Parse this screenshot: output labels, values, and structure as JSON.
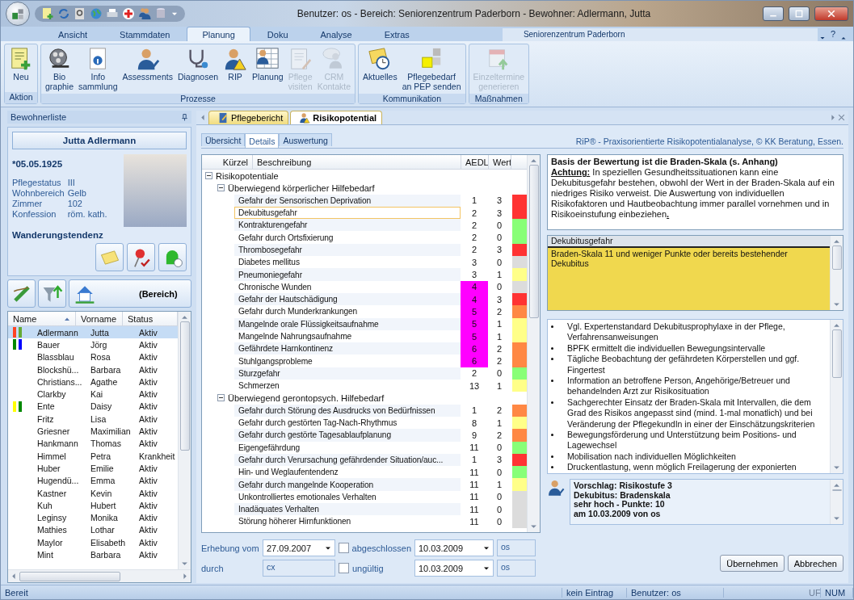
{
  "window": {
    "title": "Benutzer: os - Bereich: Seniorenzentrum Paderborn - Bewohner: Adlermann, Jutta"
  },
  "ribbon": {
    "tabs": [
      {
        "label": "Ansicht",
        "selected": false
      },
      {
        "label": "Stammdaten",
        "selected": false
      },
      {
        "label": "Planung",
        "selected": true
      },
      {
        "label": "Doku",
        "selected": false
      },
      {
        "label": "Analyse",
        "selected": false
      },
      {
        "label": "Extras",
        "selected": false
      }
    ],
    "area_label": "Seniorenzentrum Paderborn",
    "help": "?",
    "groups": [
      {
        "label": "Aktion",
        "buttons": [
          {
            "label": "Neu",
            "disabled": false
          }
        ]
      },
      {
        "label": "Prozesse",
        "buttons": [
          {
            "label": "Bio\ngraphie",
            "disabled": false
          },
          {
            "label": "Info\nsammlung",
            "disabled": false
          },
          {
            "label": "Assessments",
            "disabled": false
          },
          {
            "label": "Diagnosen",
            "disabled": false
          },
          {
            "label": "RIP",
            "disabled": false
          },
          {
            "label": "Planung",
            "disabled": false
          },
          {
            "label": "Pflege\nvisiten",
            "disabled": true
          },
          {
            "label": "CRM\nKontakte",
            "disabled": true
          }
        ]
      },
      {
        "label": "Kommunikation",
        "buttons": [
          {
            "label": "Aktuelles",
            "disabled": false
          },
          {
            "label": "Pflegebedarf\nan PEP senden",
            "disabled": false
          }
        ]
      },
      {
        "label": "Maßnahmen",
        "buttons": [
          {
            "label": "Einzeltermine\ngenerieren",
            "disabled": true
          }
        ]
      }
    ]
  },
  "sidebar": {
    "title": "Bewohnerliste",
    "resident": {
      "name": "Jutta Adlermann",
      "birth": "*05.05.1925",
      "fields": [
        {
          "label": "Pflegestatus",
          "value": "III"
        },
        {
          "label": "Wohnbereich",
          "value": "Gelb"
        },
        {
          "label": "Zimmer",
          "value": "102"
        },
        {
          "label": "Konfession",
          "value": "röm. kath."
        }
      ],
      "alert": "Wanderungstendenz"
    },
    "filter_label": "(Bereich)",
    "columns": [
      "Name",
      "Vorname",
      "Status"
    ],
    "rows": [
      {
        "name": "Adlermann",
        "first": "Jutta",
        "status": "Aktiv",
        "selected": true,
        "markers": [
          {
            "color": "#ff4422"
          },
          {
            "color": "#66aa33"
          }
        ]
      },
      {
        "name": "Bauer",
        "first": "Jörg",
        "status": "Aktiv",
        "selected": false,
        "markers": [
          {
            "color": "#008800"
          },
          {
            "color": "#0000ff"
          }
        ]
      },
      {
        "name": "Blassblau",
        "first": "Rosa",
        "status": "Aktiv",
        "selected": false,
        "markers": []
      },
      {
        "name": "Blockshü...",
        "first": "Barbara",
        "status": "Aktiv",
        "selected": false,
        "markers": []
      },
      {
        "name": "Christians...",
        "first": "Agathe",
        "status": "Aktiv",
        "selected": false,
        "markers": []
      },
      {
        "name": "Clarkby",
        "first": "Kai",
        "status": "Aktiv",
        "selected": false,
        "markers": []
      },
      {
        "name": "Ente",
        "first": "Daisy",
        "status": "Aktiv",
        "selected": false,
        "markers": [
          {
            "color": "#ffff00"
          },
          {
            "color": "#008800"
          }
        ]
      },
      {
        "name": "Fritz",
        "first": "Lisa",
        "status": "Aktiv",
        "selected": false,
        "markers": []
      },
      {
        "name": "Griesner",
        "first": "Maximilian",
        "status": "Aktiv",
        "selected": false,
        "markers": []
      },
      {
        "name": "Hankmann",
        "first": "Thomas",
        "status": "Aktiv",
        "selected": false,
        "markers": []
      },
      {
        "name": "Himmel",
        "first": "Petra",
        "status": "Krankheit",
        "selected": false,
        "markers": []
      },
      {
        "name": "Huber",
        "first": "Emilie",
        "status": "Aktiv",
        "selected": false,
        "markers": []
      },
      {
        "name": "Hugendü...",
        "first": "Emma",
        "status": "Aktiv",
        "selected": false,
        "markers": []
      },
      {
        "name": "Kastner",
        "first": "Kevin",
        "status": "Aktiv",
        "selected": false,
        "markers": []
      },
      {
        "name": "Kuh",
        "first": "Hubert",
        "status": "Aktiv",
        "selected": false,
        "markers": []
      },
      {
        "name": "Leginsy",
        "first": "Monika",
        "status": "Aktiv",
        "selected": false,
        "markers": []
      },
      {
        "name": "Mathies",
        "first": "Lothar",
        "status": "Aktiv",
        "selected": false,
        "markers": []
      },
      {
        "name": "Maylor",
        "first": "Elisabeth",
        "status": "Aktiv",
        "selected": false,
        "markers": []
      },
      {
        "name": "Mint",
        "first": "Barbara",
        "status": "Aktiv",
        "selected": false,
        "markers": []
      }
    ]
  },
  "doc_tabs": [
    {
      "label": "Pflegebericht",
      "selected": false
    },
    {
      "label": "Risikopotential",
      "selected": true
    }
  ],
  "inner_tabs": [
    {
      "label": "Übersicht",
      "selected": false
    },
    {
      "label": "Details",
      "selected": true
    },
    {
      "label": "Auswertung",
      "selected": false
    }
  ],
  "credit": "RiP® - Praxisorientierte Risikopotentialanalyse, © KK Beratung, Essen.",
  "table": {
    "columns": [
      "Kürzel",
      "Beschreibung",
      "AEDL",
      "Wert"
    ]
  },
  "risk_tree": {
    "label": "Risikopotentiale",
    "expanded": true,
    "children": [
      {
        "label": "Überwiegend körperlicher Hilfebedarf",
        "expanded": true,
        "children": [
          {
            "label": "Gefahr der Sensorischen Deprivation",
            "aedl": "1",
            "wert": "3",
            "color": "#ff3333",
            "aedl_flag": false,
            "selected": false
          },
          {
            "label": "Dekubitusgefahr",
            "aedl": "2",
            "wert": "3",
            "color": "#ff3333",
            "aedl_flag": false,
            "selected": true
          },
          {
            "label": "Kontrakturengefahr",
            "aedl": "2",
            "wert": "0",
            "color": "#88ff77",
            "aedl_flag": false,
            "selected": false
          },
          {
            "label": "Gefahr durch Ortsfixierung",
            "aedl": "2",
            "wert": "0",
            "color": "#88ff77",
            "aedl_flag": false,
            "selected": false
          },
          {
            "label": "Thrombosegefahr",
            "aedl": "2",
            "wert": "3",
            "color": "#ff3333",
            "aedl_flag": false,
            "selected": false
          },
          {
            "label": "Diabetes mellitus",
            "aedl": "3",
            "wert": "0",
            "color": "#dcdcdc",
            "aedl_flag": false,
            "selected": false
          },
          {
            "label": "Pneumoniegefahr",
            "aedl": "3",
            "wert": "1",
            "color": "#ffff88",
            "aedl_flag": false,
            "selected": false
          },
          {
            "label": "Chronische Wunden",
            "aedl": "4",
            "wert": "0",
            "color": "#dcdcdc",
            "aedl_flag": true,
            "selected": false
          },
          {
            "label": "Gefahr der Hautschädigung",
            "aedl": "4",
            "wert": "3",
            "color": "#ff3333",
            "aedl_flag": true,
            "selected": false
          },
          {
            "label": "Gefahr durch Munderkrankungen",
            "aedl": "5",
            "wert": "2",
            "color": "#ff8844",
            "aedl_flag": true,
            "selected": false
          },
          {
            "label": "Mangelnde orale Flüssigkeitsaufnahme",
            "aedl": "5",
            "wert": "1",
            "color": "#ffff88",
            "aedl_flag": true,
            "selected": false
          },
          {
            "label": "Mangelnde Nahrungsaufnahme",
            "aedl": "5",
            "wert": "1",
            "color": "#ffff88",
            "aedl_flag": true,
            "selected": false
          },
          {
            "label": "Gefährdete Harnkontinenz",
            "aedl": "6",
            "wert": "2",
            "color": "#ff8844",
            "aedl_flag": true,
            "selected": false
          },
          {
            "label": "Stuhlgangsprobleme",
            "aedl": "6",
            "wert": "2",
            "color": "#ff8844",
            "aedl_flag": true,
            "selected": false
          },
          {
            "label": "Sturzgefahr",
            "aedl": "2",
            "wert": "0",
            "color": "#88ff77",
            "aedl_flag": false,
            "selected": false
          },
          {
            "label": "Schmerzen",
            "aedl": "13",
            "wert": "1",
            "color": "#ffff88",
            "aedl_flag": false,
            "selected": false
          }
        ]
      },
      {
        "label": "Überwiegend gerontopsych. Hilfebedarf",
        "expanded": true,
        "children": [
          {
            "label": "Gefahr durch Störung des Ausdrucks von Bedürfnissen",
            "aedl": "1",
            "wert": "2",
            "color": "#ff8844",
            "aedl_flag": false,
            "selected": false
          },
          {
            "label": "Gefahr durch gestörten Tag-Nach-Rhythmus",
            "aedl": "8",
            "wert": "1",
            "color": "#ffff88",
            "aedl_flag": false,
            "selected": false
          },
          {
            "label": "Gefahr durch gestörte Tagesablaufplanung",
            "aedl": "9",
            "wert": "2",
            "color": "#ff8844",
            "aedl_flag": false,
            "selected": false
          },
          {
            "label": "Eigengefährdung",
            "aedl": "11",
            "wert": "0",
            "color": "#88ff77",
            "aedl_flag": false,
            "selected": false
          },
          {
            "label": "Gefahr durch Verursachung gefährdender Situation/auc...",
            "aedl": "1",
            "wert": "3",
            "color": "#ff3333",
            "aedl_flag": false,
            "selected": false
          },
          {
            "label": "Hin- und Weglaufentendenz",
            "aedl": "11",
            "wert": "0",
            "color": "#88ff77",
            "aedl_flag": false,
            "selected": false
          },
          {
            "label": "Gefahr durch mangelnde Kooperation",
            "aedl": "11",
            "wert": "1",
            "color": "#ffff88",
            "aedl_flag": false,
            "selected": false
          },
          {
            "label": "Unkontrolliertes emotionales Verhalten",
            "aedl": "11",
            "wert": "0",
            "color": "#dcdcdc",
            "aedl_flag": false,
            "selected": false
          },
          {
            "label": "Inadäquates Verhalten",
            "aedl": "11",
            "wert": "0",
            "color": "#dcdcdc",
            "aedl_flag": false,
            "selected": false
          },
          {
            "label": "Störung höherer Hirnfunktionen",
            "aedl": "11",
            "wert": "0",
            "color": "#dcdcdc",
            "aedl_flag": false,
            "selected": false
          }
        ]
      }
    ]
  },
  "form": {
    "survey_label": "Erhebung vom",
    "survey_date": "27.09.2007",
    "by_label": "durch",
    "by_value": "cx",
    "checks": [
      {
        "label": "abgeschlossen",
        "checked": false,
        "date": "10.03.2009",
        "user": "os"
      },
      {
        "label": "ungültig",
        "checked": false,
        "date": "10.03.2009",
        "user": "os"
      }
    ]
  },
  "info": {
    "heading": "Basis der Bewertung ist die Braden-Skala (s. Anhang)",
    "text": "**Achtung:** In speziellen Gesundheitssituationen kann eine Dekubitusgefahr bestehen, obwohl der Wert in der Braden-Skala auf ein niedriges Risiko verweist. Die Auswertung von individuellen Risikofaktoren und Hautbeobachtung immer parallel vornehmen und in Risikoeinstufung einbeziehen**.**"
  },
  "criteria": {
    "title": "Dekubitusgefahr",
    "text": "Braden-Skala 11 und weniger Punkte oder bereits bestehender Dekubitus"
  },
  "measures": [
    "Vgl. Expertenstandard Dekubitusprophylaxe in der Pflege, Verfahrensanweisungen",
    "BPFK ermittelt die individuellen Bewegungsintervalle",
    "Tägliche Beobachtung der gefährdeten Körperstellen und ggf. Fingertest",
    "Information an betroffene Person, Angehörige/Betreuer und behandelnden Arzt zur Risikosituation",
    "Sachgerechter Einsatz der Braden-Skala mit Intervallen, die dem Grad des Risikos angepasst sind (mind. 1-mal monatlich) und bei Veränderung der PflegekundIn in einer der Einschätzungskriterien",
    "Bewegungsförderung und Unterstützung beim Positions- und Lagewechsel",
    "Mobilisation nach individuellen Möglichkeiten",
    "Druckentlastung, wenn möglich Freilagerung der exponierten"
  ],
  "proposal": [
    "Vorschlag: Risikostufe 3",
    "Dekubitus: Bradenskala",
    "sehr hoch - Punkte: 10",
    "am 10.03.2009 von os"
  ],
  "buttons": [
    "Übernehmen",
    "Abbrechen"
  ],
  "status_bar": {
    "left": "Bereit",
    "entry": "kein Eintrag",
    "user": "Benutzer: os",
    "uf": "UF",
    "num": "NUM"
  }
}
